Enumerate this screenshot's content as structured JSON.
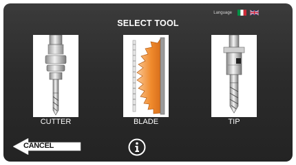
{
  "header": {
    "title": "SELECT TOOL",
    "language_label": "Language",
    "languages": [
      {
        "code": "it",
        "icon": "italy-flag-icon"
      },
      {
        "code": "en",
        "icon": "uk-flag-icon"
      }
    ]
  },
  "tools": [
    {
      "label": "CUTTER",
      "icon": "cutter-tool-icon"
    },
    {
      "label": "BLADE",
      "icon": "blade-tool-icon"
    },
    {
      "label": "TIP",
      "icon": "tip-tool-icon"
    }
  ],
  "footer": {
    "cancel_label": "CANCEL",
    "info_icon": "info-icon"
  },
  "colors": {
    "background": "#2c2c2c",
    "text": "#ffffff",
    "blade_accent": "#f08a2c",
    "button_fill": "#ffffff"
  }
}
